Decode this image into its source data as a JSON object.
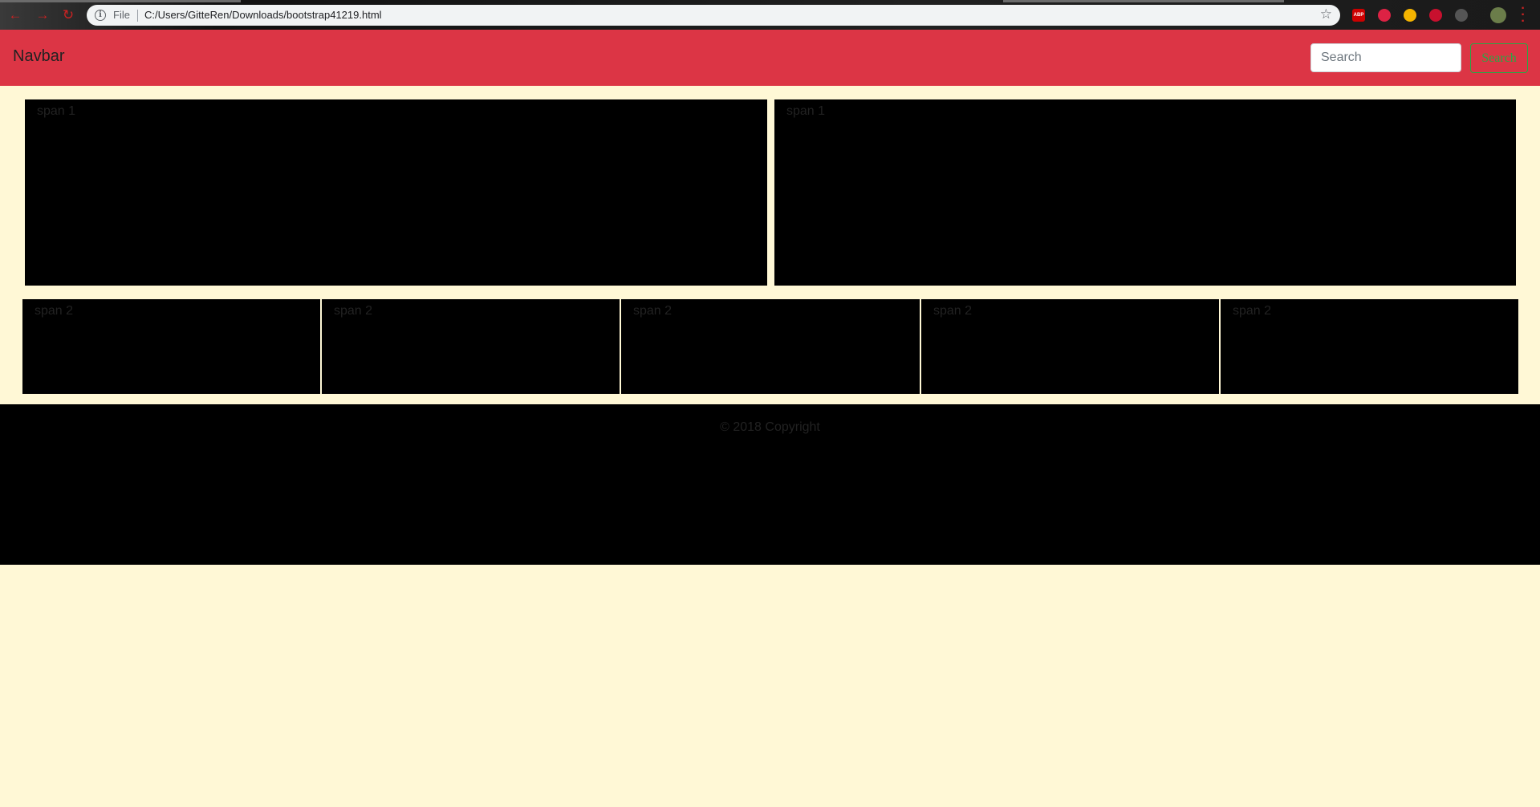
{
  "browser": {
    "file_label": "File",
    "url": "C:/Users/GitteRen/Downloads/bootstrap41219.html",
    "nav_icons": [
      "back-arrow-icon",
      "forward-arrow-icon",
      "reload-icon"
    ],
    "extensions": [
      {
        "name": "adblock-plus-icon",
        "label": "ABP",
        "color": "#cc0000"
      },
      {
        "name": "record-extension-icon",
        "label": "",
        "color": "#dd2244"
      },
      {
        "name": "compass-extension-icon",
        "label": "",
        "color": "#f5b400"
      },
      {
        "name": "ublock-icon",
        "label": "",
        "color": "#c8102e"
      },
      {
        "name": "dark-mode-extension-icon",
        "label": "",
        "color": "#555555"
      },
      {
        "name": "profile-avatar-icon",
        "label": "",
        "color": "#6b7d4a"
      }
    ]
  },
  "navbar": {
    "brand": "Navbar",
    "search_placeholder": "Search",
    "search_button": "Search",
    "background": "#dc3545"
  },
  "row1": [
    {
      "label": "span 1"
    },
    {
      "label": "span 1"
    }
  ],
  "row2": [
    {
      "label": "span 2"
    },
    {
      "label": "span 2"
    },
    {
      "label": "span 2"
    },
    {
      "label": "span 2"
    },
    {
      "label": "span 2"
    }
  ],
  "footer": {
    "text": "© 2018 Copyright"
  },
  "colors": {
    "page_background": "#fff8d6",
    "block_background": "#000000",
    "button_outline": "#28a745"
  }
}
